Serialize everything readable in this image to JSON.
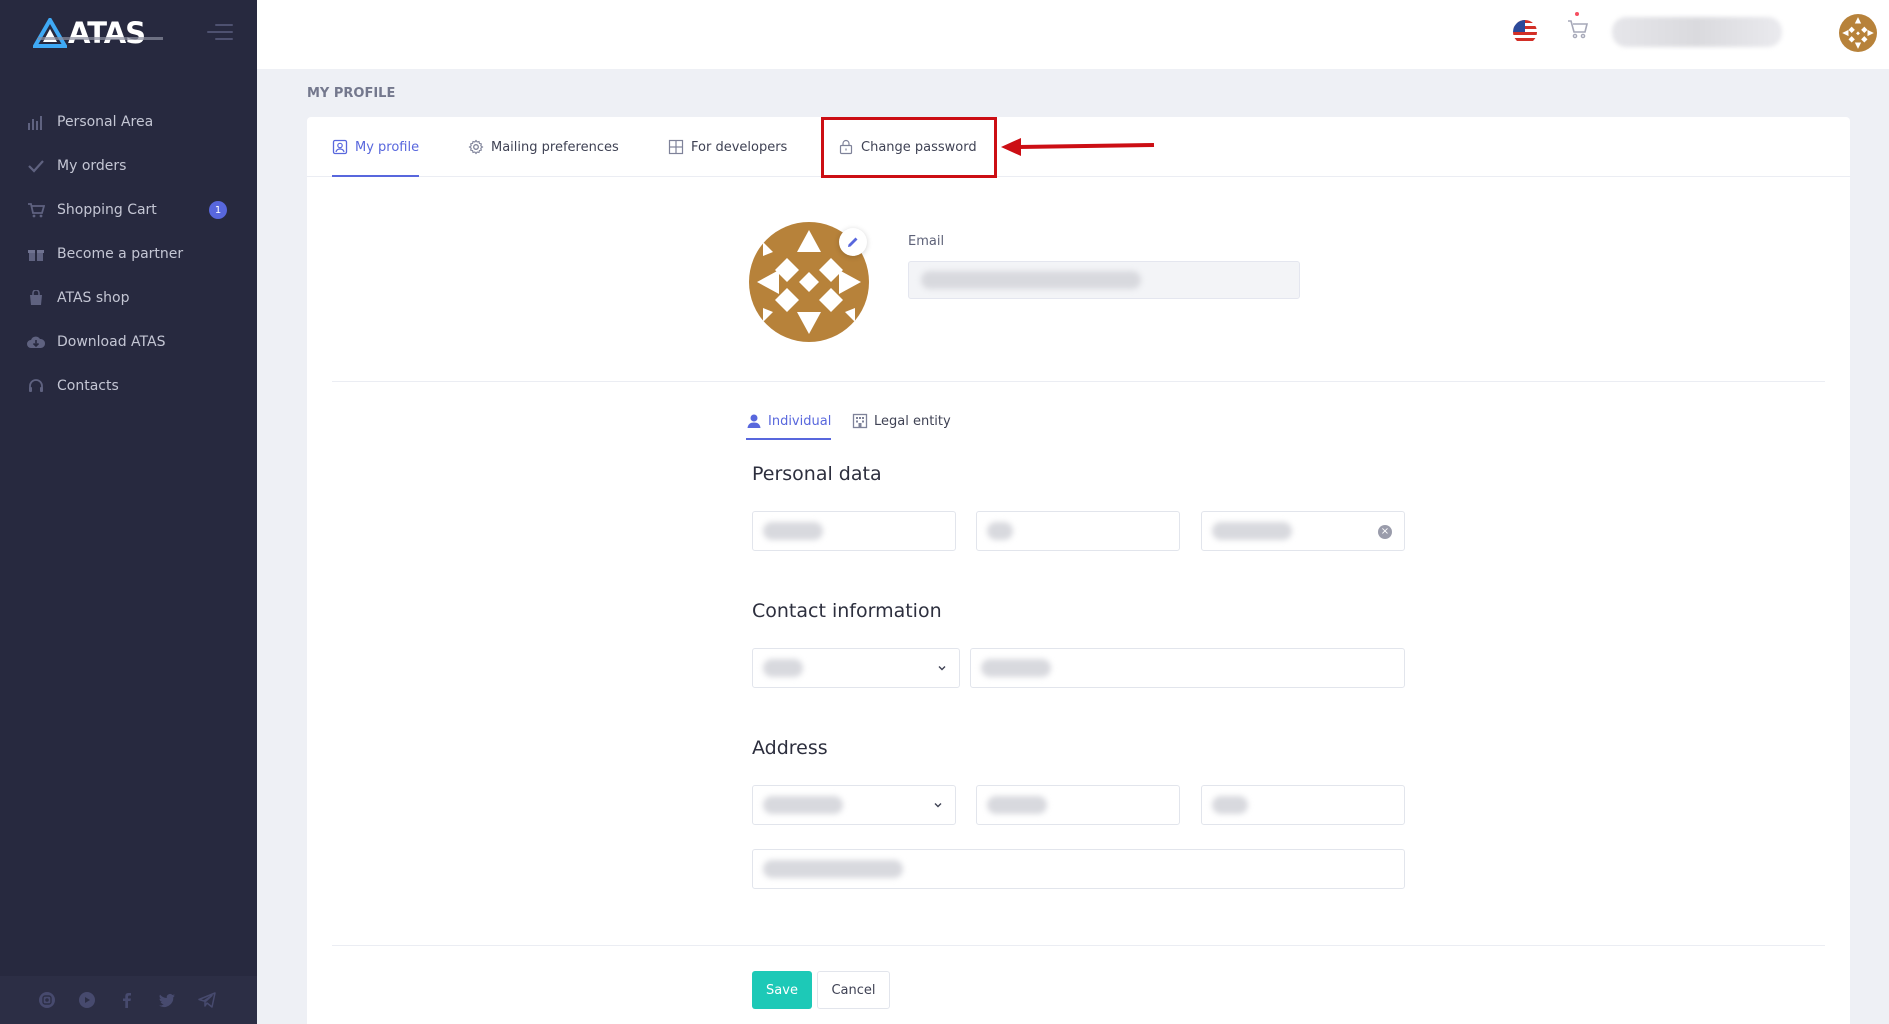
{
  "brand": {
    "name": "ATAS",
    "accent": "#5867dd",
    "sidebar_bg": "#27293f"
  },
  "sidebar": {
    "items": [
      {
        "label": "Personal Area",
        "icon": "chart-bars-icon"
      },
      {
        "label": "My orders",
        "icon": "check-icon"
      },
      {
        "label": "Shopping Cart",
        "icon": "cart-icon",
        "badge": "1"
      },
      {
        "label": "Become a partner",
        "icon": "gift-icon"
      },
      {
        "label": "ATAS shop",
        "icon": "bag-icon"
      },
      {
        "label": "Download ATAS",
        "icon": "cloud-download-icon"
      },
      {
        "label": "Contacts",
        "icon": "headset-icon"
      }
    ],
    "social": [
      "instagram-icon",
      "youtube-icon",
      "facebook-icon",
      "twitter-icon",
      "telegram-icon"
    ]
  },
  "header": {
    "language": "English (US)"
  },
  "page": {
    "title": "MY PROFILE"
  },
  "tabs": [
    {
      "label": "My profile",
      "icon": "profile-icon",
      "active": true
    },
    {
      "label": "Mailing preferences",
      "icon": "gear-icon",
      "active": false
    },
    {
      "label": "For developers",
      "icon": "grid-icon",
      "active": false
    },
    {
      "label": "Change password",
      "icon": "lock-icon",
      "active": false
    }
  ],
  "profile": {
    "email_label": "Email"
  },
  "subtabs": [
    {
      "label": "Individual",
      "icon": "user-icon",
      "active": true
    },
    {
      "label": "Legal entity",
      "icon": "building-icon",
      "active": false
    }
  ],
  "sections": {
    "personal": "Personal data",
    "contact": "Contact information",
    "address": "Address"
  },
  "buttons": {
    "save": "Save",
    "cancel": "Cancel"
  },
  "annotation": {
    "highlight_color": "#cc0e14"
  }
}
